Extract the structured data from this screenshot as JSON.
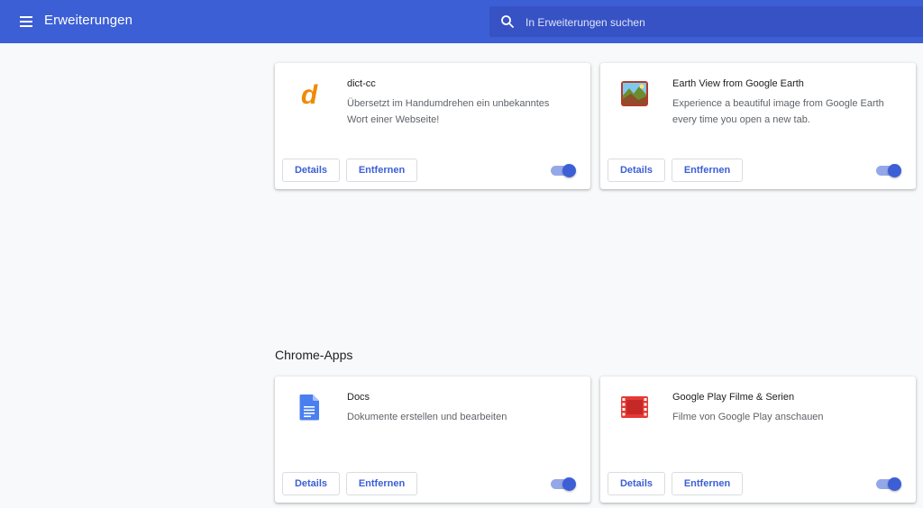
{
  "toolbar": {
    "title": "Erweiterungen",
    "search_placeholder": "In Erweiterungen suchen",
    "menu_icon": "hamburger-menu-icon",
    "search_icon": "search-icon"
  },
  "colors": {
    "accent": "#3c5fd6",
    "toggle_track": "#94a7e8",
    "background": "#f8f9fa"
  },
  "extensions": [
    {
      "name": "dict-cc",
      "description": "Übersetzt im Handumdrehen ein unbekanntes Wort einer Webseite!",
      "icon": "dict-cc-logo-icon",
      "details_label": "Details",
      "remove_label": "Entfernen",
      "enabled": true
    },
    {
      "name": "Earth View from Google Earth",
      "description": "Experience a beautiful image from Google Earth every time you open a new tab.",
      "icon": "earth-view-icon",
      "details_label": "Details",
      "remove_label": "Entfernen",
      "enabled": true
    }
  ],
  "apps_section": {
    "title": "Chrome-Apps",
    "items": [
      {
        "name": "Docs",
        "description": "Dokumente erstellen und bearbeiten",
        "icon": "google-docs-icon",
        "details_label": "Details",
        "remove_label": "Entfernen",
        "enabled": true
      },
      {
        "name": "Google Play Filme & Serien",
        "description": "Filme von Google Play anschauen",
        "icon": "film-strip-icon",
        "details_label": "Details",
        "remove_label": "Entfernen",
        "enabled": true
      }
    ]
  }
}
